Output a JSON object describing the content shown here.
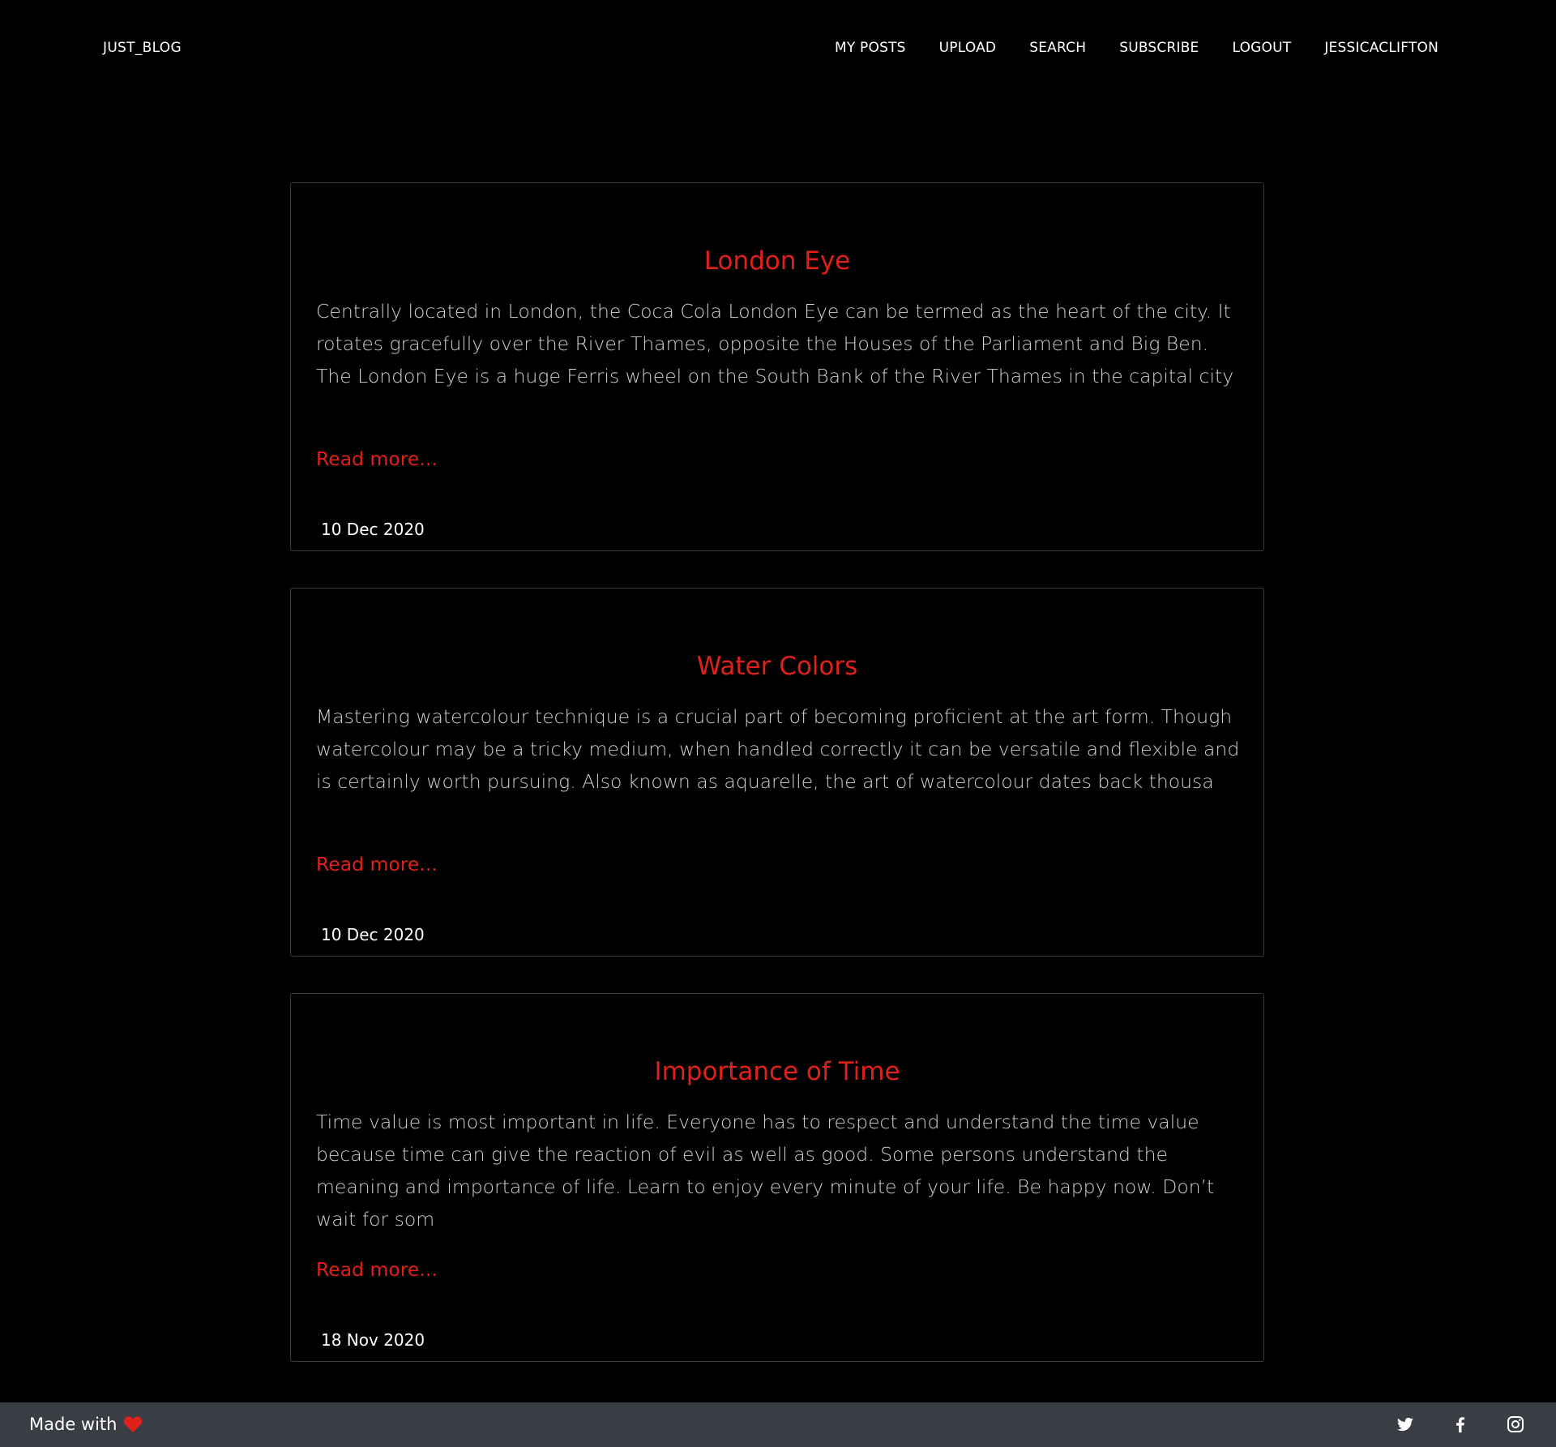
{
  "header": {
    "brand": "JUST_BLOG",
    "nav": [
      "MY POSTS",
      "UPLOAD",
      "SEARCH",
      "SUBSCRIBE",
      "LOGOUT",
      "JESSICACLIFTON"
    ]
  },
  "posts": [
    {
      "title": "London Eye",
      "excerpt": "Centrally located in London, the Coca Cola London Eye can be termed as the heart of the city. It rotates gracefully over the River Thames, opposite the Houses of the Parliament and Big Ben. The London Eye is a huge Ferris wheel on the South Bank of the River Thames in the capital city",
      "read_more": "Read more...",
      "date": "10 Dec 2020"
    },
    {
      "title": "Water Colors",
      "excerpt": "Mastering watercolour technique is a crucial part of becoming proficient at the art form. Though watercolour may be a tricky medium, when handled correctly it can be versatile and flexible and is certainly worth pursuing. Also known as aquarelle, the art of watercolour dates back thousa",
      "read_more": "Read more...",
      "date": "10 Dec 2020"
    },
    {
      "title": "Importance of Time",
      "excerpt": "Time value is most important in life. Everyone has to respect and understand the time value because time can give the reaction of evil as well as good. Some persons understand the meaning and importance of life. Learn to enjoy every minute of your life. Be happy now. Don’t wait for som",
      "read_more": "Read more...",
      "date": "18 Nov 2020"
    }
  ],
  "footer": {
    "made_with": "Made with",
    "heart_icon": "heart-icon",
    "socials": [
      "twitter-icon",
      "facebook-icon",
      "instagram-icon"
    ]
  },
  "colors": {
    "background": "#000000",
    "accent": "#e0201a",
    "footer_bg": "#3a3d44",
    "card_border": "#3a3a3a"
  }
}
